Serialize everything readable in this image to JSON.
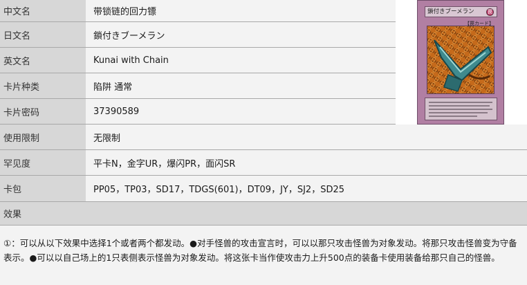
{
  "rows": [
    {
      "label": "中文名",
      "value": "带锁链的回力镖"
    },
    {
      "label": "日文名",
      "value": "鎖付きブーメラン"
    },
    {
      "label": "英文名",
      "value": "Kunai with Chain"
    },
    {
      "label": "卡片种类",
      "value": "陷阱 通常"
    },
    {
      "label": "卡片密码",
      "value": "37390589"
    },
    {
      "label": "使用限制",
      "value": "无限制"
    },
    {
      "label": "罕见度",
      "value": "平卡N，金字UR，爆闪PR，面闪SR"
    },
    {
      "label": "卡包",
      "value": "PP05，TP03，SD17，TDGS(601)，DT09，JY，SJ2，SD25"
    }
  ],
  "effect": {
    "label": "效果",
    "text": "①：可以从以下效果中选择1个或者两个都发动。●对手怪兽的攻击宣言时，可以以那只攻击怪兽为对象发动。将那只攻击怪兽变为守备表示。●可以以自己场上的1只表侧表示怪兽为对象发动。将这张卡当作使攻击力上升500点的装备卡使用装备给那只自己的怪兽。"
  },
  "card_image": {
    "name": "鎖付きブーメラン",
    "attribute_glyph": "罠",
    "type_tag": "【罠カード】",
    "frame_color": "#b17fa3",
    "art_icon": "chained-boomerang-icon"
  }
}
